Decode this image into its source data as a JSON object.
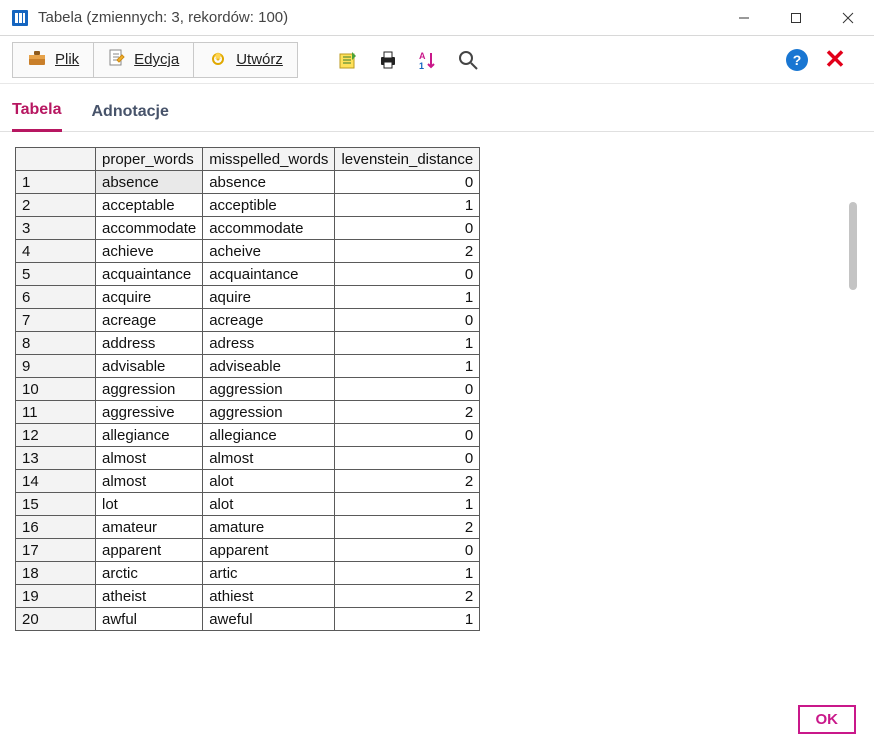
{
  "window": {
    "title": "Tabela (zmiennych: 3, rekordów: 100)"
  },
  "menubar": {
    "file": "Plik",
    "edit": "Edycja",
    "create": "Utwórz"
  },
  "tabs": {
    "table": "Tabela",
    "annotations": "Adnotacje"
  },
  "columns": {
    "c0": "",
    "c1": "proper_words",
    "c2": "misspelled_words",
    "c3": "levenstein_distance"
  },
  "rows": [
    {
      "n": "1",
      "a": "absence",
      "b": "absence",
      "d": "0",
      "sel": true
    },
    {
      "n": "2",
      "a": "acceptable",
      "b": "acceptible",
      "d": "1"
    },
    {
      "n": "3",
      "a": "accommodate",
      "b": "accommodate",
      "d": "0"
    },
    {
      "n": "4",
      "a": "achieve",
      "b": "acheive",
      "d": "2"
    },
    {
      "n": "5",
      "a": "acquaintance",
      "b": "acquaintance",
      "d": "0"
    },
    {
      "n": "6",
      "a": "acquire",
      "b": "aquire",
      "d": "1"
    },
    {
      "n": "7",
      "a": "acreage",
      "b": "acreage",
      "d": "0"
    },
    {
      "n": "8",
      "a": "address",
      "b": "adress",
      "d": "1"
    },
    {
      "n": "9",
      "a": "advisable",
      "b": "adviseable",
      "d": "1"
    },
    {
      "n": "10",
      "a": "aggression",
      "b": "aggression",
      "d": "0"
    },
    {
      "n": "11",
      "a": "aggressive",
      "b": "aggression",
      "d": "2"
    },
    {
      "n": "12",
      "a": "allegiance",
      "b": "allegiance",
      "d": "0"
    },
    {
      "n": "13",
      "a": "almost",
      "b": "almost",
      "d": "0"
    },
    {
      "n": "14",
      "a": "almost",
      "b": "alot",
      "d": "2"
    },
    {
      "n": "15",
      "a": "lot",
      "b": "alot",
      "d": "1"
    },
    {
      "n": "16",
      "a": "amateur",
      "b": "amature",
      "d": "2"
    },
    {
      "n": "17",
      "a": "apparent",
      "b": "apparent",
      "d": "0"
    },
    {
      "n": "18",
      "a": "arctic",
      "b": "artic",
      "d": "1"
    },
    {
      "n": "19",
      "a": "atheist",
      "b": "athiest",
      "d": "2"
    },
    {
      "n": "20",
      "a": "awful",
      "b": "aweful",
      "d": "1"
    }
  ],
  "footer": {
    "ok": "OK"
  },
  "colors": {
    "accent": "#b71761"
  }
}
